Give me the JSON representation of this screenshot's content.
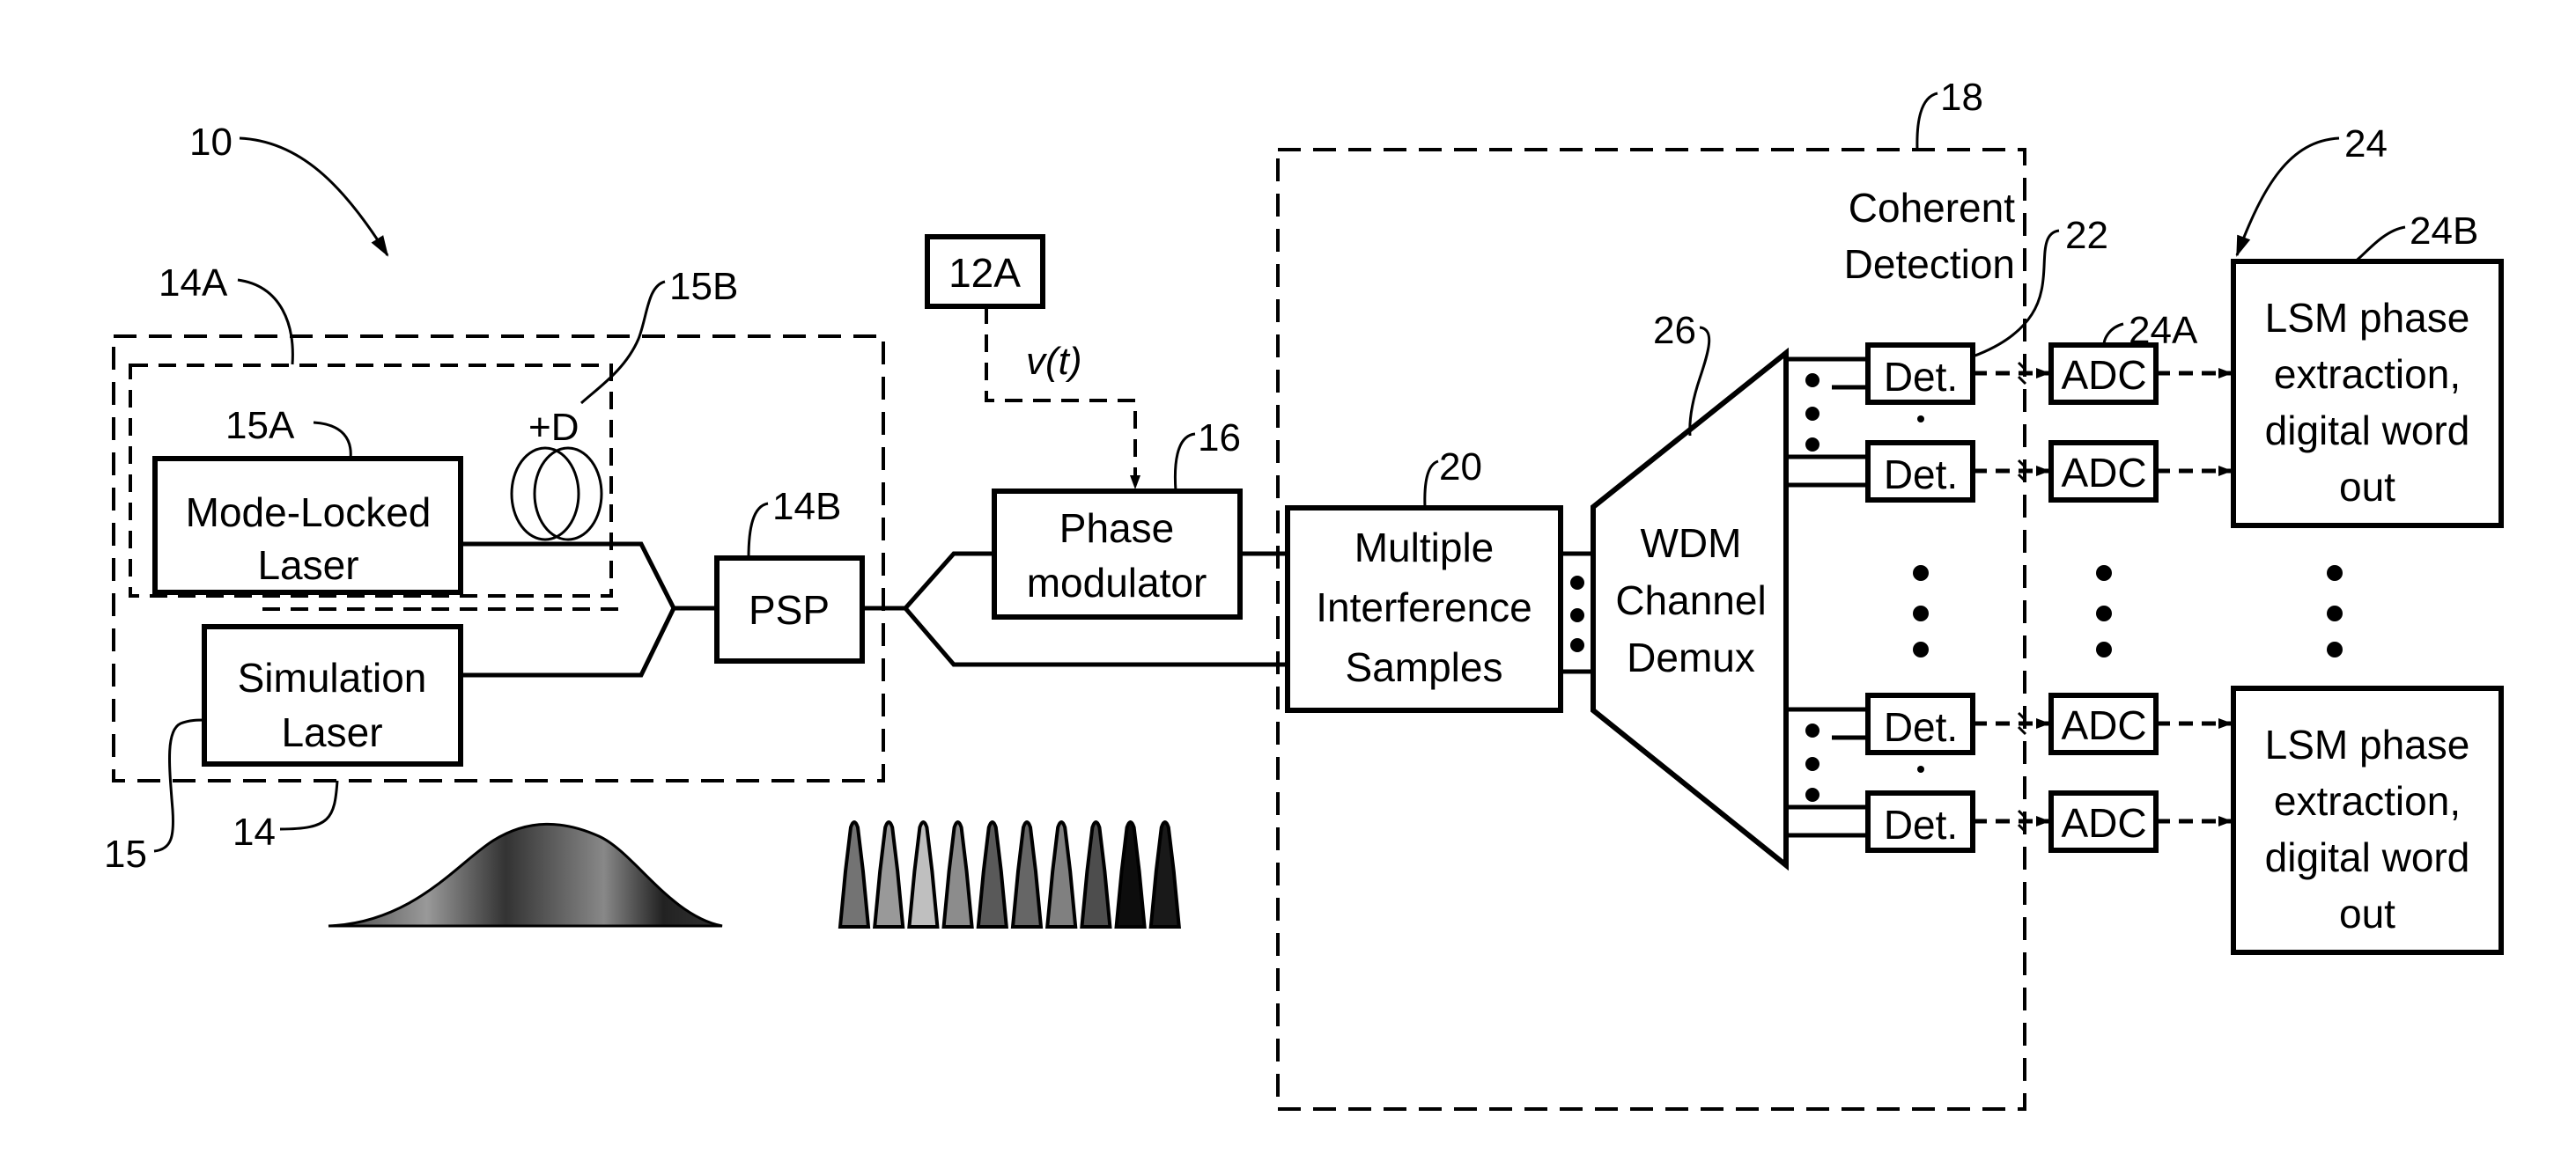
{
  "figure": {
    "type": "patent block diagram",
    "colors": {
      "ink": "#000000",
      "paper": "#ffffff",
      "pulse_fill": "#3a3a3a",
      "bump_fill": "#555555"
    }
  },
  "refs": {
    "system": "10",
    "source_group": "14",
    "source_inner": "14A",
    "psp_ref": "14B",
    "sim_laser_ref": "15",
    "ml_laser_ref": "15A",
    "dispersion_ref": "15B",
    "signal_ref": "12A",
    "modulator_ref": "16",
    "detection_group": "18",
    "mis_ref": "20",
    "det_ref": "22",
    "backend_ref": "24",
    "adc_ref": "24A",
    "lsm_ref": "24B",
    "demux_ref": "26"
  },
  "blocks": {
    "mode_locked_laser": [
      "Mode-Locked",
      "Laser"
    ],
    "simulation_laser": [
      "Simulation",
      "Laser"
    ],
    "psp": "PSP",
    "signal_source": "12A",
    "dispersion": "+D",
    "signal_label": "v(t)",
    "phase_modulator": [
      "Phase",
      "modulator"
    ],
    "mis": [
      "Multiple",
      "Interference",
      "Samples"
    ],
    "wdm": [
      "WDM",
      "Channel",
      "Demux"
    ],
    "coherent_detection": [
      "Coherent",
      "Detection"
    ],
    "detector": "Det.",
    "adc": "ADC",
    "lsm": [
      "LSM phase",
      "extraction,",
      "digital word",
      "out"
    ]
  },
  "detector_rows": 4,
  "pulse_train": {
    "count": 10,
    "shades": [
      0.55,
      0.4,
      0.25,
      0.45,
      0.65,
      0.6,
      0.5,
      0.7,
      0.95,
      0.9
    ]
  }
}
